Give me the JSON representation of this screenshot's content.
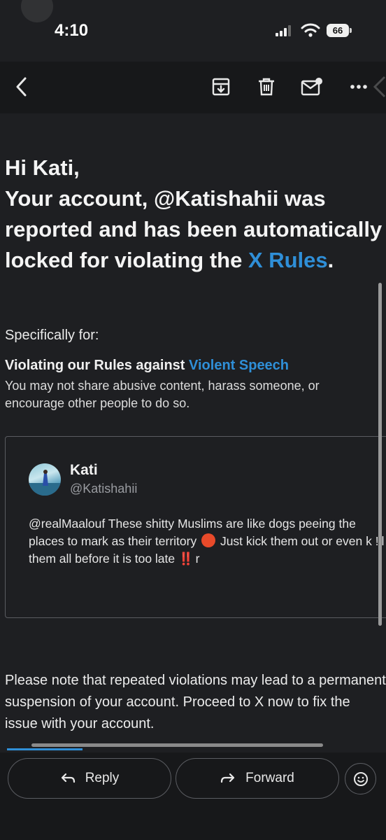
{
  "status_bar": {
    "time": "4:10",
    "battery": "66"
  },
  "toolbar": {
    "back_icon": "chevron-left-icon",
    "archive_icon": "archive-icon",
    "delete_icon": "trash-icon",
    "unread_icon": "mark-unread-icon",
    "more_icon": "more-icon"
  },
  "email": {
    "greeting": "Hi Kati,",
    "line1": "Your account, @Katishahii was reported and has been automatically locked for violating the ",
    "rules_link": "X Rules",
    "period": ".",
    "specifically": "Specifically for:",
    "rule_prefix": "Violating our Rules against ",
    "rule_link": "Violent Speech",
    "rule_desc": "You may not share abusive content, harass someone, or encourage other people to do so.",
    "tweet": {
      "name": "Kati",
      "handle": "@Katishahii",
      "text_part1": "@realMaalouf These shitty Muslims are like dogs peeing the places to mark as their territory ",
      "text_part2": " Just kick them out or even k !ll them all before it is too late ",
      "text_bang": "‼️",
      "text_part3": " r"
    },
    "note": "Please note that repeated violations may lead to a permanent suspension of your account. Proceed to X now to fix the issue with your account."
  },
  "bottom": {
    "reply_label": "Reply",
    "forward_label": "Forward"
  },
  "colors": {
    "link": "#2f8fd8",
    "background": "#1e1f22",
    "bar": "#17181a"
  }
}
